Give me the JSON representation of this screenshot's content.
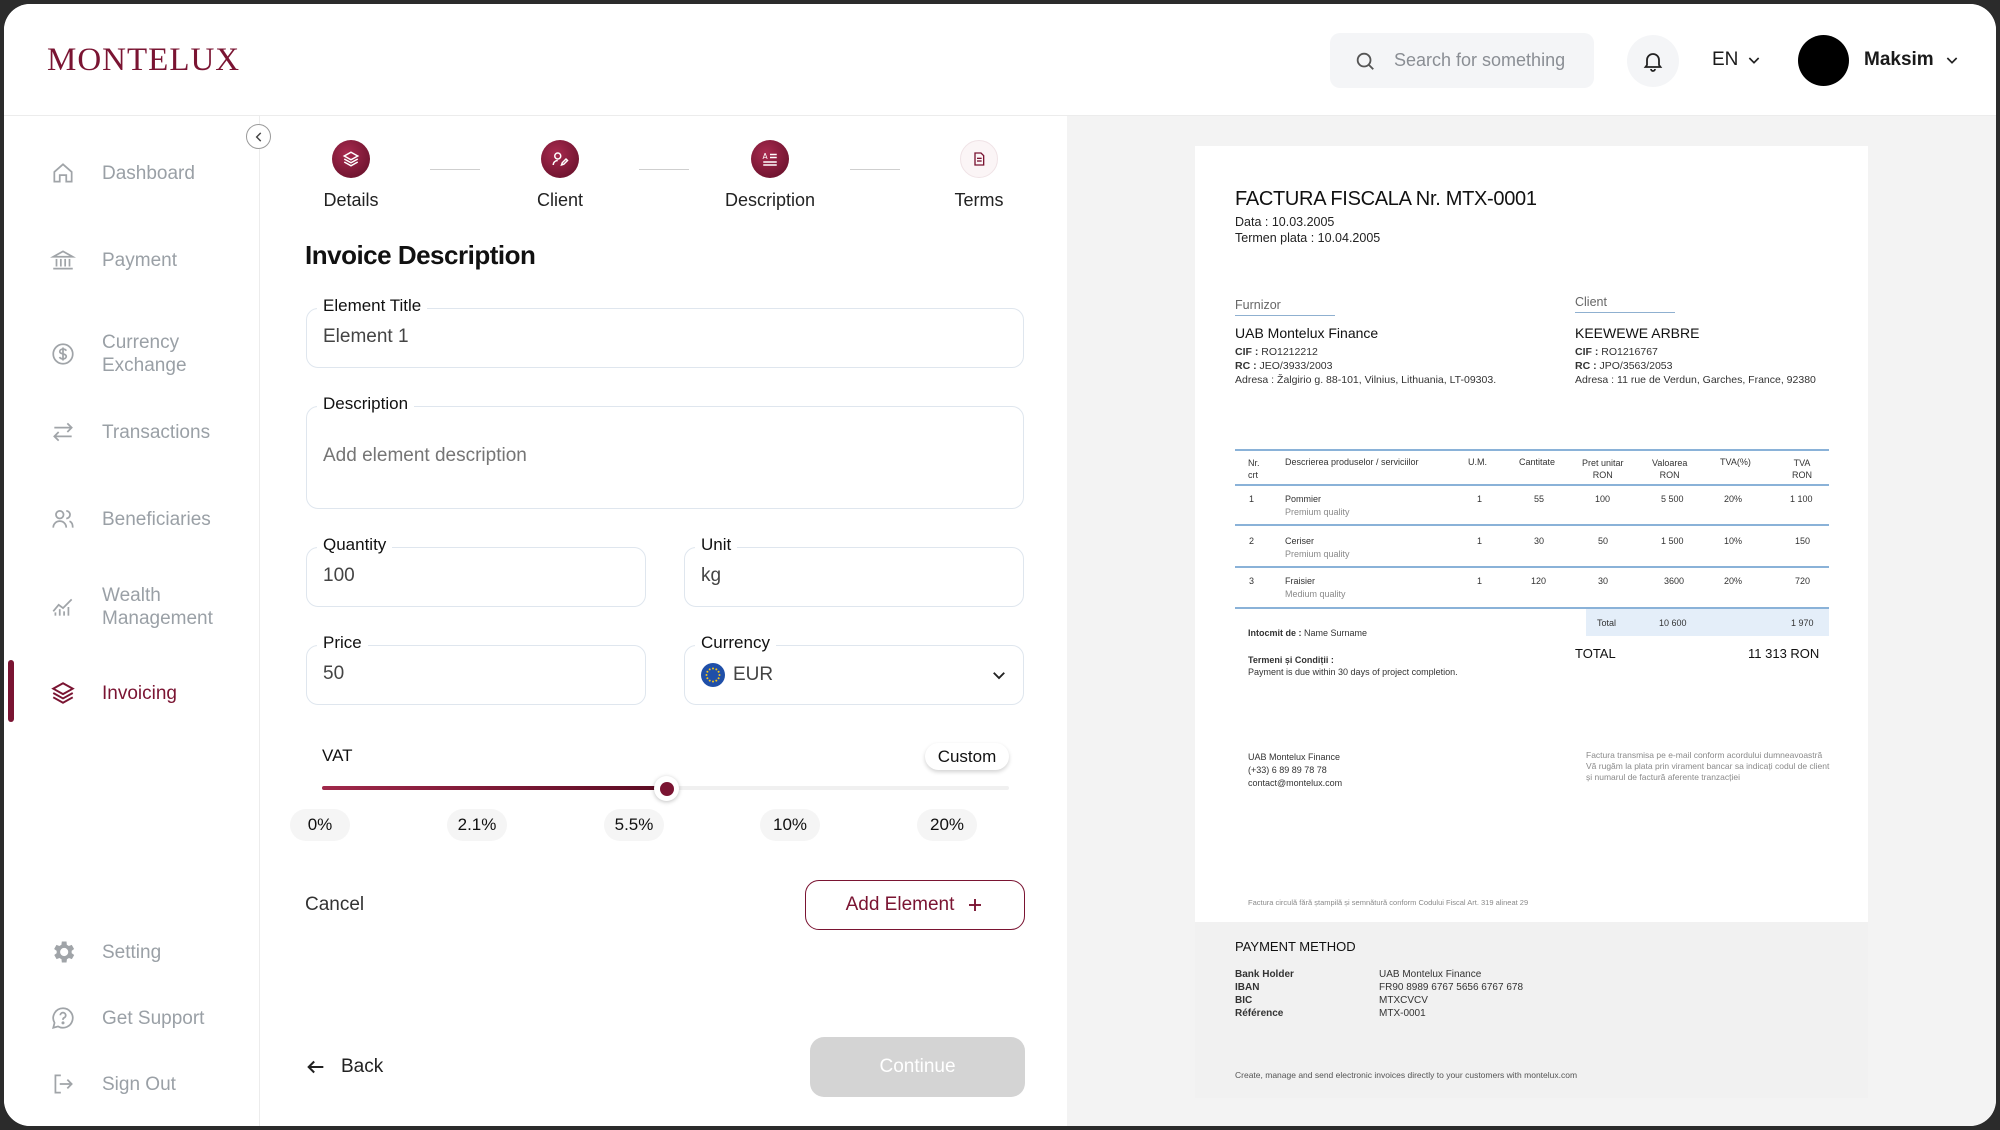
{
  "app": {
    "logo": "MONTELUX"
  },
  "header": {
    "search_placeholder": "Search for something",
    "language": "EN",
    "user_name": "Maksim"
  },
  "sidebar": {
    "items": [
      {
        "label": "Dashboard",
        "icon": "home-icon"
      },
      {
        "label": "Payment",
        "icon": "bank-icon"
      },
      {
        "label": "Currency\nExchange",
        "icon": "dollar-circle-icon"
      },
      {
        "label": "Transactions",
        "icon": "transfer-arrows-icon"
      },
      {
        "label": "Beneficiaries",
        "icon": "users-icon"
      },
      {
        "label": "Wealth\nManagement",
        "icon": "chart-icon"
      },
      {
        "label": "Invoicing",
        "icon": "layers-icon",
        "active": true
      }
    ],
    "bottom": [
      {
        "label": "Setting",
        "icon": "gear-icon"
      },
      {
        "label": "Get Support",
        "icon": "support-icon"
      },
      {
        "label": "Sign Out",
        "icon": "sign-out-icon"
      }
    ]
  },
  "steps": [
    {
      "label": "Details",
      "state": "done"
    },
    {
      "label": "Client",
      "state": "done"
    },
    {
      "label": "Description",
      "state": "current"
    },
    {
      "label": "Terms",
      "state": "pending"
    }
  ],
  "form": {
    "title": "Invoice Description",
    "element_title_label": "Element Title",
    "element_title_value": "Element 1",
    "description_label": "Description",
    "description_placeholder": "Add element description",
    "quantity_label": "Quantity",
    "quantity_value": "100",
    "unit_label": "Unit",
    "unit_value": "kg",
    "price_label": "Price",
    "price_value": "50",
    "currency_label": "Currency",
    "currency_value": "EUR",
    "vat_label": "VAT",
    "vat_custom": "Custom",
    "vat_options": [
      "0%",
      "2.1%",
      "5.5%",
      "10%",
      "20%"
    ],
    "vat_selected_index": 2,
    "cancel": "Cancel",
    "add_element": "Add Element",
    "back": "Back",
    "continue": "Continue"
  },
  "invoice": {
    "title": "FACTURA FISCALA Nr. MTX-0001",
    "date": "Data : 10.03.2005",
    "due": "Termen plata : 10.04.2005",
    "supplier_header": "Furnizor",
    "supplier_name": "UAB Montelux Finance",
    "supplier_cif": "RO1212212",
    "supplier_rc": "JEO/3933/2003",
    "supplier_address": "Žalgirio g. 88-101, Vilnius, Lithuania, LT-09303.",
    "client_header": "Client",
    "client_name": "KEEWEWE ARBRE",
    "client_cif": "RO1216767",
    "client_rc": "JPO/3563/2053",
    "client_address": "11 rue de Verdun, Garches, France, 92380",
    "cif_label": "CIF :",
    "rc_label": "RC :",
    "address_label": "Adresa :",
    "table": {
      "headers": [
        "Nr.\ncrt",
        "Descrierea produselor / serviciilor",
        "U.M.",
        "Cantitate",
        "Pret unitar\nRON",
        "Valoarea\nRON",
        "TVA(%)",
        "TVA\nRON"
      ],
      "rows": [
        {
          "nr": "1",
          "name": "Pommier",
          "quality": "Premium quality",
          "um": "1",
          "qty": "55",
          "price": "100",
          "value": "5 500",
          "vat_pct": "20%",
          "vat": "1 100"
        },
        {
          "nr": "2",
          "name": "Ceriser",
          "quality": "Premium quality",
          "um": "1",
          "qty": "30",
          "price": "50",
          "value": "1 500",
          "vat_pct": "10%",
          "vat": "150"
        },
        {
          "nr": "3",
          "name": "Fraisier",
          "quality": "Medium quality",
          "um": "1",
          "qty": "120",
          "price": "30",
          "value": "3600",
          "vat_pct": "20%",
          "vat": "720"
        }
      ],
      "total_label": "Total",
      "total_value": "10 600",
      "total_vat": "1 970"
    },
    "prepared_label": "Intocmit de :",
    "prepared_value": "Name Surname",
    "terms_label": "Termeni și Condiții :",
    "terms_value": "Payment is due within 30 days of project completion.",
    "grand_total_label": "TOTAL",
    "grand_total_value": "11 313 RON",
    "contact_name": "UAB Montelux Finance",
    "contact_phone": "(+33) 6 89 89 78 78",
    "contact_email": "contact@montelux.com",
    "note_lines": [
      "Factura transmisa pe e-mail conform acordului dumneavoastră",
      "Vă rugăm la plata prin virament bancar sa indicați codul de client",
      "și numarul de factură aferente tranzacției"
    ],
    "legal_note": "Factura circulă fără ștampilă și semnătură conform Codului Fiscal Art. 319 alineat 29",
    "payment_method_title": "PAYMENT METHOD",
    "payment": [
      {
        "label": "Bank Holder",
        "value": "UAB Montelux Finance"
      },
      {
        "label": "IBAN",
        "value": "FR90 8989 6767 5656 6767 678"
      },
      {
        "label": "BIC",
        "value": "MTXCVCV"
      },
      {
        "label": "Référence",
        "value": "MTX-0001"
      }
    ],
    "footer": "Create, manage and send electronic invoices directly to your customers with montelux.com"
  },
  "colors": {
    "brand": "#7a1432",
    "field_border": "#dfe6ee",
    "table_line": "#8ab2d8"
  }
}
